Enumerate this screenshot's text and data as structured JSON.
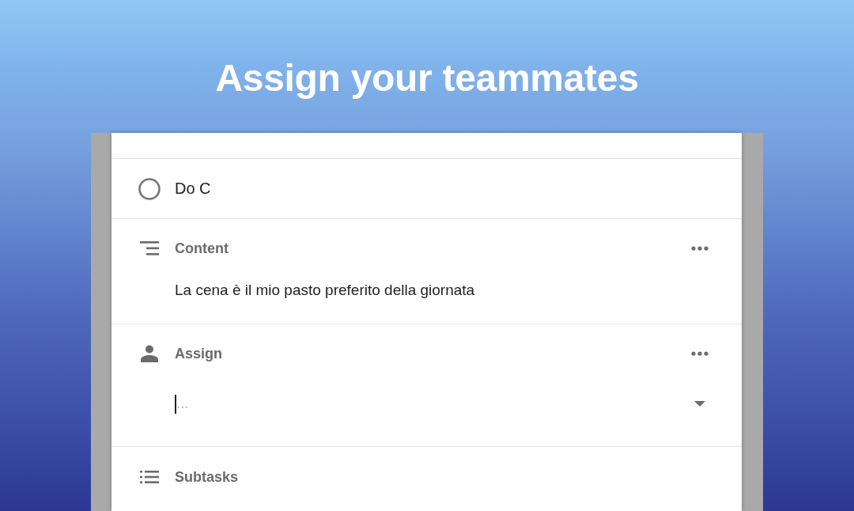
{
  "header": {
    "title": "Assign your teammates"
  },
  "task": {
    "title": "Do C",
    "completed": false
  },
  "sections": [
    {
      "kind": "content",
      "label": "Content",
      "menu": true,
      "text": "La cena è il mio pasto preferito della giornata"
    },
    {
      "kind": "assign",
      "label": "Assign",
      "menu": true,
      "field": {
        "placeholder": "...",
        "focused": true
      }
    },
    {
      "kind": "subtasks",
      "label": "Subtasks",
      "menu": false
    }
  ]
}
